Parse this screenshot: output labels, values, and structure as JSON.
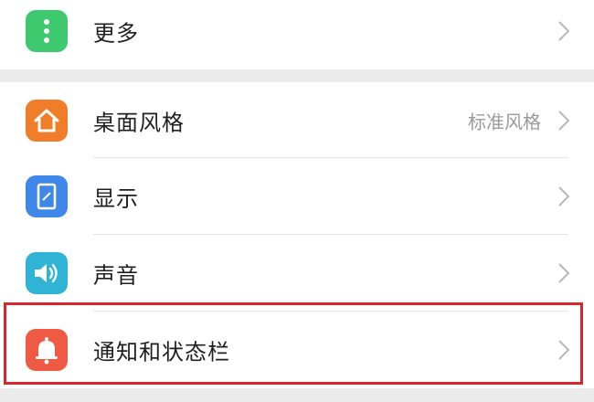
{
  "settings": {
    "items": [
      {
        "label": "更多",
        "value": "",
        "icon": "more-dots-icon",
        "icon_color": "#3ec96f"
      },
      {
        "label": "桌面风格",
        "value": "标准风格",
        "icon": "home-icon",
        "icon_color": "#f07d2a"
      },
      {
        "label": "显示",
        "value": "",
        "icon": "display-icon",
        "icon_color": "#3f87e8"
      },
      {
        "label": "声音",
        "value": "",
        "icon": "speaker-icon",
        "icon_color": "#2fb4d6"
      },
      {
        "label": "通知和状态栏",
        "value": "",
        "icon": "bell-icon",
        "icon_color": "#ee5a43"
      }
    ]
  },
  "colors": {
    "background": "#ffffff",
    "section_gap": "#ebebeb",
    "divider": "#e4e4e4",
    "label_text": "#1f1f1f",
    "value_text": "#9a9a9a",
    "chevron": "#b8b8b8",
    "highlight_border": "#d9262e"
  },
  "highlighted_item": "通知和状态栏"
}
